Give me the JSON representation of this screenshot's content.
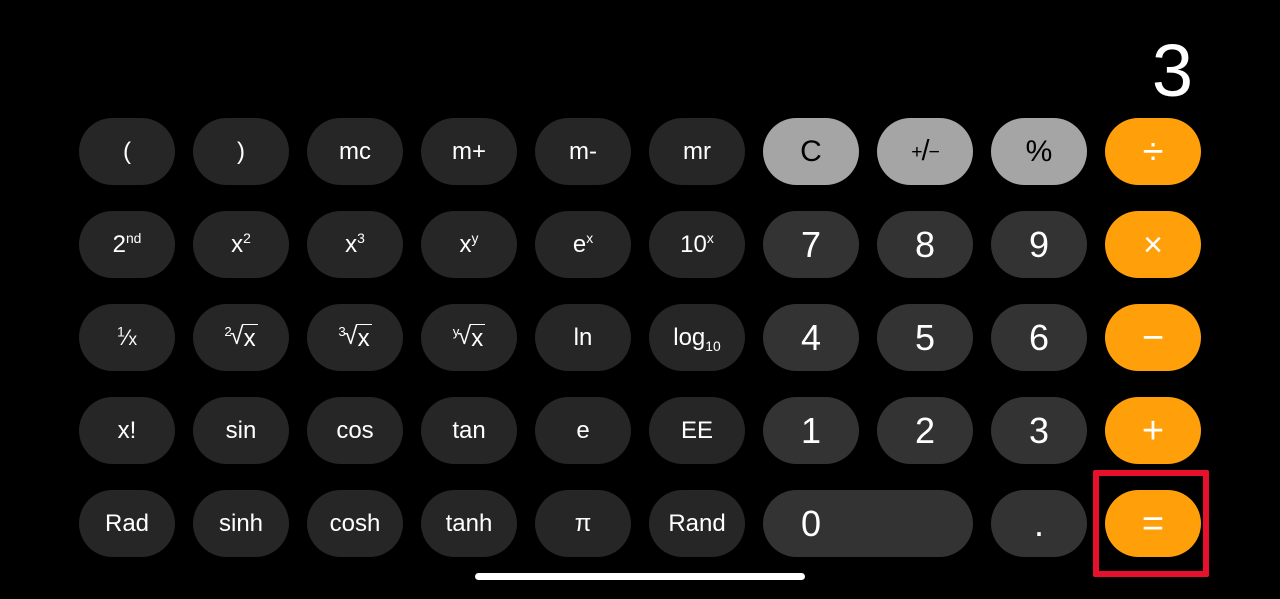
{
  "app": {
    "name": "Calculator",
    "mode": "scientific",
    "background_color": "#000000"
  },
  "display": {
    "value": "3"
  },
  "colors": {
    "function_key": "#262626",
    "number_key": "#333333",
    "utility_key": "#a5a5a5",
    "operator_key": "#ff9f0a",
    "highlight": "#e8112d",
    "text_light": "#ffffff",
    "text_dark": "#000000"
  },
  "keypad": {
    "rows": [
      {
        "keys": [
          {
            "label": "(",
            "name": "key-open-paren",
            "type": "fn"
          },
          {
            "label": ")",
            "name": "key-close-paren",
            "type": "fn"
          },
          {
            "label": "mc",
            "name": "key-mc",
            "type": "fn"
          },
          {
            "label": "m+",
            "name": "key-m-plus",
            "type": "fn"
          },
          {
            "label": "m-",
            "name": "key-m-minus",
            "type": "fn"
          },
          {
            "label": "mr",
            "name": "key-mr",
            "type": "fn"
          },
          {
            "label": "C",
            "name": "key-clear",
            "type": "util"
          },
          {
            "label": "+/-",
            "name": "key-sign-toggle",
            "type": "util"
          },
          {
            "label": "%",
            "name": "key-percent",
            "type": "util"
          },
          {
            "label": "÷",
            "name": "key-divide",
            "type": "op"
          }
        ]
      },
      {
        "keys": [
          {
            "label": "2nd",
            "name": "key-second",
            "type": "fn"
          },
          {
            "label": "x2",
            "name": "key-x-squared",
            "type": "fn"
          },
          {
            "label": "x3",
            "name": "key-x-cubed",
            "type": "fn"
          },
          {
            "label": "xy",
            "name": "key-x-power-y",
            "type": "fn"
          },
          {
            "label": "ex",
            "name": "key-e-power-x",
            "type": "fn"
          },
          {
            "label": "10x",
            "name": "key-ten-power-x",
            "type": "fn"
          },
          {
            "label": "7",
            "name": "key-7",
            "type": "num"
          },
          {
            "label": "8",
            "name": "key-8",
            "type": "num"
          },
          {
            "label": "9",
            "name": "key-9",
            "type": "num"
          },
          {
            "label": "×",
            "name": "key-multiply",
            "type": "op"
          }
        ]
      },
      {
        "keys": [
          {
            "label": "1/x",
            "name": "key-reciprocal",
            "type": "fn"
          },
          {
            "label": "2√x",
            "name": "key-square-root",
            "type": "fn"
          },
          {
            "label": "3√x",
            "name": "key-cube-root",
            "type": "fn"
          },
          {
            "label": "y√x",
            "name": "key-y-root-x",
            "type": "fn"
          },
          {
            "label": "ln",
            "name": "key-ln",
            "type": "fn"
          },
          {
            "label": "log10",
            "name": "key-log-base-10",
            "type": "fn"
          },
          {
            "label": "4",
            "name": "key-4",
            "type": "num"
          },
          {
            "label": "5",
            "name": "key-5",
            "type": "num"
          },
          {
            "label": "6",
            "name": "key-6",
            "type": "num"
          },
          {
            "label": "−",
            "name": "key-subtract",
            "type": "op"
          }
        ]
      },
      {
        "keys": [
          {
            "label": "x!",
            "name": "key-factorial",
            "type": "fn"
          },
          {
            "label": "sin",
            "name": "key-sin",
            "type": "fn"
          },
          {
            "label": "cos",
            "name": "key-cos",
            "type": "fn"
          },
          {
            "label": "tan",
            "name": "key-tan",
            "type": "fn"
          },
          {
            "label": "e",
            "name": "key-euler",
            "type": "fn"
          },
          {
            "label": "EE",
            "name": "key-ee",
            "type": "fn"
          },
          {
            "label": "1",
            "name": "key-1",
            "type": "num"
          },
          {
            "label": "2",
            "name": "key-2",
            "type": "num"
          },
          {
            "label": "3",
            "name": "key-3",
            "type": "num"
          },
          {
            "label": "+",
            "name": "key-add",
            "type": "op"
          }
        ]
      },
      {
        "keys": [
          {
            "label": "Rad",
            "name": "key-rad",
            "type": "fn"
          },
          {
            "label": "sinh",
            "name": "key-sinh",
            "type": "fn"
          },
          {
            "label": "cosh",
            "name": "key-cosh",
            "type": "fn"
          },
          {
            "label": "tanh",
            "name": "key-tanh",
            "type": "fn"
          },
          {
            "label": "π",
            "name": "key-pi",
            "type": "fn"
          },
          {
            "label": "Rand",
            "name": "key-rand",
            "type": "fn"
          },
          {
            "label": "0",
            "name": "key-0",
            "type": "num"
          },
          {
            "label": ".",
            "name": "key-decimal",
            "type": "num"
          },
          {
            "label": "=",
            "name": "key-equals",
            "type": "op"
          }
        ]
      }
    ]
  },
  "annotations": {
    "highlight_target": "key-equals",
    "highlight_color": "#e8112d"
  },
  "system": {
    "home_indicator": true
  }
}
